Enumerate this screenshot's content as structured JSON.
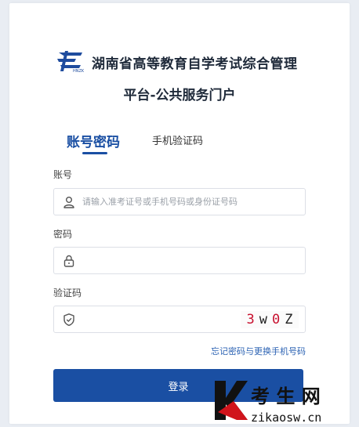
{
  "header": {
    "title_line1": "湖南省高等教育自学考试综合管理",
    "title_line2": "平台-公共服务门户"
  },
  "tabs": [
    {
      "label": "账号密码",
      "active": true
    },
    {
      "label": "手机验证码",
      "active": false
    }
  ],
  "form": {
    "account_label": "账号",
    "account_placeholder": "请输入准考证号或手机号码或身份证号码",
    "password_label": "密码",
    "captcha_label": "验证码",
    "captcha_chars": [
      "3",
      "w",
      "0",
      "Z"
    ]
  },
  "forgot_link": "忘记密码与更换手机号码",
  "login_button": "登录",
  "watermark": {
    "title": "考 生 网",
    "url": "zikaosw.cn"
  },
  "colors": {
    "primary": "#1a4fa3",
    "link": "#2b62b3",
    "watermark_red": "#d0141c"
  }
}
